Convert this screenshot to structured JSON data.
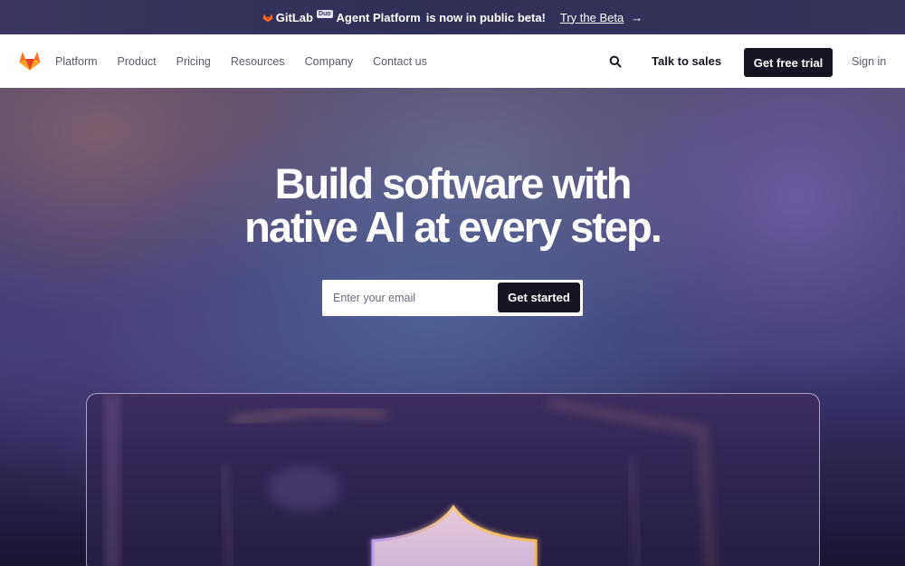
{
  "announcement": {
    "brand": "GitLab",
    "badge": "Duo",
    "product": "Agent Platform",
    "message": "is now in public beta!",
    "link": "Try the Beta",
    "arrow": "→"
  },
  "nav": {
    "items": [
      "Platform",
      "Product",
      "Pricing",
      "Resources",
      "Company",
      "Contact us"
    ],
    "talk_to_sales": "Talk to sales",
    "free_trial": "Get free trial",
    "sign_in": "Sign in"
  },
  "hero": {
    "headline_line1": "Build software with",
    "headline_line2": "native AI at every step.",
    "email_placeholder": "Enter your email",
    "cta": "Get started"
  },
  "colors": {
    "brand_orange": "#fc6d26",
    "dark": "#171321",
    "hero_purple": "#3e3c79"
  },
  "icons": {
    "logo": "gitlab-tanuki-icon",
    "search": "search-icon"
  }
}
